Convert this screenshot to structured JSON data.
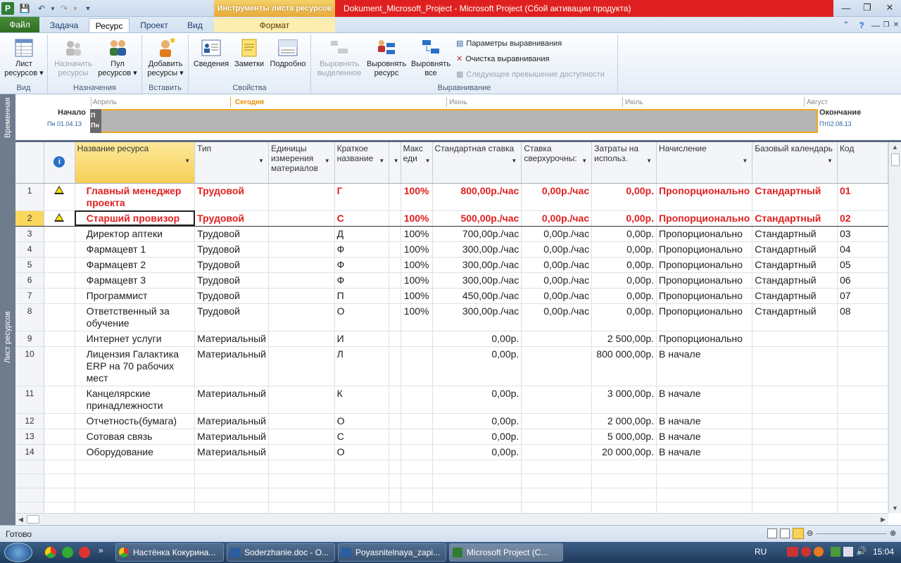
{
  "titlebar": {
    "context_tools": "Инструменты листа ресурсов",
    "title": "Dokument_Microsoft_Project  -  Microsoft Project (Сбой активации продукта)"
  },
  "tabs": [
    "Файл",
    "Задача",
    "Ресурс",
    "Проект",
    "Вид",
    "Формат"
  ],
  "ribbon": {
    "view_group": {
      "label": "Вид",
      "button": "Лист ресурсов"
    },
    "assign_group": {
      "label": "Назначения",
      "assign": "Назначить ресурсы",
      "pool": "Пул ресурсов"
    },
    "insert_group": {
      "label": "Вставить",
      "add": "Добавить ресурсы"
    },
    "props_group": {
      "label": "Свойства",
      "info": "Сведения",
      "notes": "Заметки",
      "details": "Подробно"
    },
    "level_group": {
      "label": "Выравнивание",
      "level_selection": "Выровнять выделенное",
      "level_resource": "Выровнять ресурс",
      "level_all": "Выровнять все",
      "options": "Параметры выравнивания",
      "clear": "Очистка выравнивания",
      "next": "Следующее превышение доступности"
    }
  },
  "timeline": {
    "side_label": "Временная",
    "start_label": "Начало",
    "start_date": "Пн 01.04.13",
    "end_label": "Окончание",
    "end_date": "Пт02.08.13",
    "months": [
      "Апрель",
      "Сегодня",
      "Июнь",
      "Июль",
      "Август"
    ],
    "stub": "П Пн"
  },
  "sheet": {
    "side_label": "Лист ресурсов",
    "columns": [
      "Название ресурса",
      "Тип",
      "Единицы измерения материалов",
      "Краткое название",
      "",
      "Макс еди",
      "Стандартная ставка",
      "Ставка сверхурочны:",
      "Затраты на использ.",
      "Начисление",
      "Базовый календарь",
      "Код"
    ],
    "rows": [
      {
        "n": "1",
        "warn": true,
        "name": "Главный менеджер проекта",
        "type": "Трудовой",
        "unit": "",
        "short": "Г",
        "max": "100%",
        "std": "800,00р./час",
        "ovt": "0,00р./час",
        "cost": "0,00р.",
        "accr": "Пропорционально",
        "cal": "Стандартный",
        "code": "01"
      },
      {
        "n": "2",
        "warn": true,
        "name": "Старший провизор",
        "type": "Трудовой",
        "unit": "",
        "short": "С",
        "max": "100%",
        "std": "500,00р./час",
        "ovt": "0,00р./час",
        "cost": "0,00р.",
        "accr": "Пропорционально",
        "cal": "Стандартный",
        "code": "02"
      },
      {
        "n": "3",
        "warn": false,
        "name": "Директор аптеки",
        "type": "Трудовой",
        "unit": "",
        "short": "Д",
        "max": "100%",
        "std": "700,00р./час",
        "ovt": "0,00р./час",
        "cost": "0,00р.",
        "accr": "Пропорционально",
        "cal": "Стандартный",
        "code": "03"
      },
      {
        "n": "4",
        "warn": false,
        "name": "Фармацевт 1",
        "type": "Трудовой",
        "unit": "",
        "short": "Ф",
        "max": "100%",
        "std": "300,00р./час",
        "ovt": "0,00р./час",
        "cost": "0,00р.",
        "accr": "Пропорционально",
        "cal": "Стандартный",
        "code": "04"
      },
      {
        "n": "5",
        "warn": false,
        "name": "Фармацевт 2",
        "type": "Трудовой",
        "unit": "",
        "short": "Ф",
        "max": "100%",
        "std": "300,00р./час",
        "ovt": "0,00р./час",
        "cost": "0,00р.",
        "accr": "Пропорционально",
        "cal": "Стандартный",
        "code": "05"
      },
      {
        "n": "6",
        "warn": false,
        "name": "Фармацевт 3",
        "type": "Трудовой",
        "unit": "",
        "short": "Ф",
        "max": "100%",
        "std": "300,00р./час",
        "ovt": "0,00р./час",
        "cost": "0,00р.",
        "accr": "Пропорционально",
        "cal": "Стандартный",
        "code": "06"
      },
      {
        "n": "7",
        "warn": false,
        "name": "Программист",
        "type": "Трудовой",
        "unit": "",
        "short": "П",
        "max": "100%",
        "std": "450,00р./час",
        "ovt": "0,00р./час",
        "cost": "0,00р.",
        "accr": "Пропорционально",
        "cal": "Стандартный",
        "code": "07"
      },
      {
        "n": "8",
        "warn": false,
        "name": "Ответственный за обучение",
        "type": "Трудовой",
        "unit": "",
        "short": "О",
        "max": "100%",
        "std": "300,00р./час",
        "ovt": "0,00р./час",
        "cost": "0,00р.",
        "accr": "Пропорционально",
        "cal": "Стандартный",
        "code": "08"
      },
      {
        "n": "9",
        "warn": false,
        "name": "Интернет услуги",
        "type": "Материальный",
        "unit": "",
        "short": "И",
        "max": "",
        "std": "0,00р.",
        "ovt": "",
        "cost": "2 500,00р.",
        "accr": "Пропорционально",
        "cal": "",
        "code": ""
      },
      {
        "n": "10",
        "warn": false,
        "name": "Лицензия Галактика ERP на 70 рабочих мест",
        "type": "Материальный",
        "unit": "",
        "short": "Л",
        "max": "",
        "std": "0,00р.",
        "ovt": "",
        "cost": "800 000,00р.",
        "accr": "В начале",
        "cal": "",
        "code": ""
      },
      {
        "n": "11",
        "warn": false,
        "name": "Канцелярские принадлежности",
        "type": "Материальный",
        "unit": "",
        "short": "К",
        "max": "",
        "std": "0,00р.",
        "ovt": "",
        "cost": "3 000,00р.",
        "accr": "В начале",
        "cal": "",
        "code": ""
      },
      {
        "n": "12",
        "warn": false,
        "name": "Отчетность(бумага)",
        "type": "Материальный",
        "unit": "",
        "short": "О",
        "max": "",
        "std": "0,00р.",
        "ovt": "",
        "cost": "2 000,00р.",
        "accr": "В начале",
        "cal": "",
        "code": ""
      },
      {
        "n": "13",
        "warn": false,
        "name": "Сотовая связь",
        "type": "Материальный",
        "unit": "",
        "short": "С",
        "max": "",
        "std": "0,00р.",
        "ovt": "",
        "cost": "5 000,00р.",
        "accr": "В начале",
        "cal": "",
        "code": ""
      },
      {
        "n": "14",
        "warn": false,
        "name": "Оборудование",
        "type": "Материальный",
        "unit": "",
        "short": "О",
        "max": "",
        "std": "0,00р.",
        "ovt": "",
        "cost": "20 000,00р.",
        "accr": "В начале",
        "cal": "",
        "code": ""
      }
    ]
  },
  "statusbar": {
    "status": "Готово"
  },
  "taskbar": {
    "items": [
      "Настёнка Кокурина...",
      "Soderzhanie.doc - O...",
      "Poyasnitelnaya_zapi...",
      "Microsoft Project (C..."
    ],
    "lang": "RU",
    "time": "15:04"
  },
  "colors": {
    "accent_red": "#e02020",
    "file_tab": "#2f6e22",
    "timeline_border": "#f2a81d"
  }
}
